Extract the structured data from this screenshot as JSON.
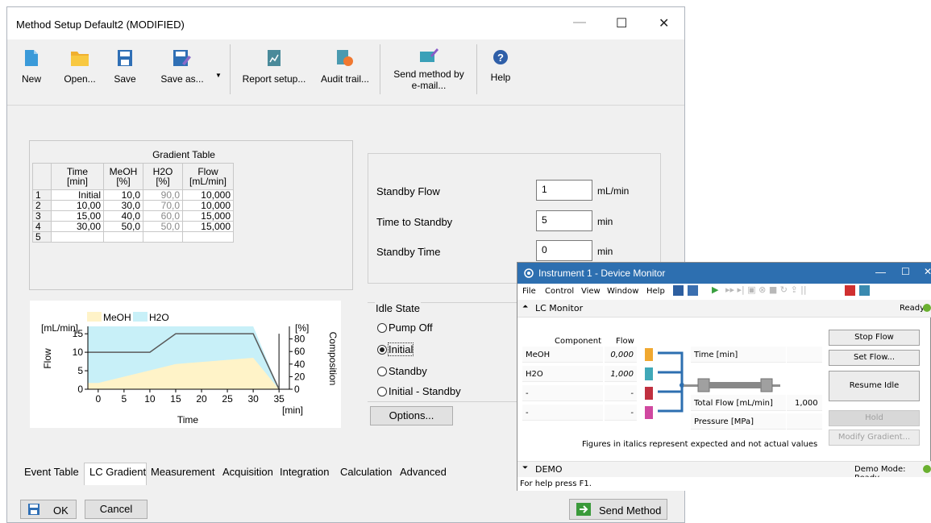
{
  "window": {
    "title": "Method Setup Default2 (MODIFIED)",
    "min": "—",
    "max": "☐",
    "close": "✕"
  },
  "toolbar": {
    "new": "New",
    "open": "Open...",
    "save": "Save",
    "save_as": "Save as...",
    "report_setup": "Report setup...",
    "audit_trail": "Audit trail...",
    "send_email_1": "Send method by",
    "send_email_2": "e-mail...",
    "help": "Help"
  },
  "gradient": {
    "title": "Gradient Table",
    "headers": [
      [
        "Time",
        "[min]"
      ],
      [
        "MeOH",
        "[%]"
      ],
      [
        "H2O",
        "[%]"
      ],
      [
        "Flow",
        "[mL/min]"
      ]
    ],
    "rows": [
      {
        "n": "1",
        "time": "Initial",
        "meoh": "10,0",
        "h2o": "90,0",
        "flow": "10,000"
      },
      {
        "n": "2",
        "time": "10,00",
        "meoh": "30,0",
        "h2o": "70,0",
        "flow": "10,000"
      },
      {
        "n": "3",
        "time": "15,00",
        "meoh": "40,0",
        "h2o": "60,0",
        "flow": "15,000"
      },
      {
        "n": "4",
        "time": "30,00",
        "meoh": "50,0",
        "h2o": "50,0",
        "flow": "15,000"
      },
      {
        "n": "5",
        "time": "",
        "meoh": "",
        "h2o": "",
        "flow": ""
      }
    ]
  },
  "chart_data": {
    "type": "area",
    "xlabel": "Time",
    "xunit": "[min]",
    "ylabel": "Flow",
    "yunit": "[mL/min]",
    "y2label": "Composition",
    "y2unit": "[%]",
    "legend": [
      "MeOH",
      "H2O"
    ],
    "x_ticks": [
      "0",
      "5",
      "10",
      "15",
      "20",
      "25",
      "30",
      "35"
    ],
    "y_ticks": [
      "0",
      "5",
      "10",
      "15"
    ],
    "y2_ticks": [
      "0",
      "20",
      "40",
      "60",
      "80"
    ],
    "xlim": [
      -2,
      37
    ],
    "ylim": [
      0,
      17
    ],
    "y2lim": [
      0,
      100
    ],
    "series": [
      {
        "name": "MeOH",
        "color": "#fff3c8",
        "points": [
          [
            -2,
            10
          ],
          [
            0,
            10
          ],
          [
            10,
            30
          ],
          [
            15,
            40
          ],
          [
            30,
            50
          ],
          [
            35,
            0
          ]
        ]
      },
      {
        "name": "H2O",
        "color": "#c8f0f8",
        "points": [
          [
            -2,
            100
          ],
          [
            30,
            100
          ],
          [
            35,
            0
          ]
        ]
      },
      {
        "name": "Flow",
        "color": "#5a5a5a",
        "points": [
          [
            -2,
            10
          ],
          [
            10,
            10
          ],
          [
            15,
            15
          ],
          [
            30,
            15
          ],
          [
            35,
            0
          ],
          [
            35,
            15
          ]
        ]
      }
    ]
  },
  "standby": {
    "flow_label": "Standby Flow",
    "flow_value": "1",
    "flow_unit": "mL/min",
    "time_to_label": "Time to Standby",
    "time_to_value": "5",
    "time_to_unit": "min",
    "time_label": "Standby Time",
    "time_value": "0",
    "time_unit": "min"
  },
  "idle": {
    "title": "Idle State",
    "options": [
      "Pump Off",
      "Initial",
      "Standby",
      "Initial - Standby"
    ],
    "selected": "Initial"
  },
  "options_button": "Options...",
  "tabs": [
    "Event Table",
    "LC Gradient",
    "Measurement",
    "Acquisition",
    "Integration",
    "Calculation",
    "Advanced"
  ],
  "active_tab": "LC Gradient",
  "footer": {
    "ok": "OK",
    "cancel": "Cancel",
    "send": "Send Method"
  },
  "monitor": {
    "title": "Instrument 1 - Device Monitor",
    "menu": [
      "File",
      "Control",
      "View",
      "Window",
      "Help"
    ],
    "section": "LC Monitor",
    "status": "Ready",
    "col_component": "Component",
    "col_flow": "Flow",
    "components": [
      {
        "name": "MeOH",
        "flow": "0,000",
        "color": "#f0a830"
      },
      {
        "name": "H2O",
        "flow": "1,000",
        "color": "#40a8b8"
      },
      {
        "name": "-",
        "flow": "-",
        "color": "#c03040"
      },
      {
        "name": "-",
        "flow": "-",
        "color": "#d048a0"
      }
    ],
    "time_label": "Time [min]",
    "total_flow_label": "Total Flow [mL/min]",
    "total_flow_value": "1,000",
    "pressure_label": "Pressure [MPa]",
    "buttons": [
      "Stop Flow",
      "Set Flow...",
      "Resume Idle",
      "Hold",
      "Modify Gradient..."
    ],
    "note": "Figures in italics represent expected and not actual values",
    "demo": "DEMO",
    "demo_status": "Demo Mode: Ready",
    "help_bar": "For help press F1."
  }
}
